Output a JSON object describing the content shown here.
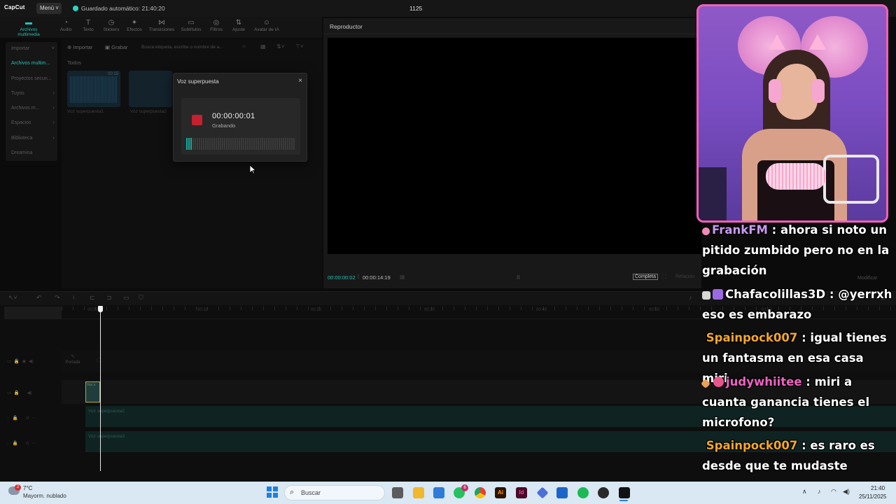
{
  "app": {
    "logo": "CapCut",
    "menu_label": "Menú",
    "autosave": "Guardado automático: 21:40:20",
    "project_title": "1125"
  },
  "tool_tabs": [
    {
      "label": "Archivos multimedia",
      "icon": "media-icon"
    },
    {
      "label": "Audio",
      "icon": "audio-icon"
    },
    {
      "label": "Texto",
      "icon": "text-icon"
    },
    {
      "label": "Stickers",
      "icon": "sticker-icon"
    },
    {
      "label": "Efectos",
      "icon": "effects-icon"
    },
    {
      "label": "Transiciones",
      "icon": "transitions-icon"
    },
    {
      "label": "Subtítulos",
      "icon": "subtitles-icon"
    },
    {
      "label": "Filtros",
      "icon": "filters-icon"
    },
    {
      "label": "Ajuste",
      "icon": "adjust-icon"
    },
    {
      "label": "Avatar de IA",
      "icon": "avatar-icon"
    }
  ],
  "left_nav": [
    {
      "label": "Importar",
      "chevron": "˅"
    },
    {
      "label": "Archivos multim..."
    },
    {
      "label": "Proyectos secun..."
    },
    {
      "label": "Tuyos",
      "chevron": "›"
    },
    {
      "label": "Archivos m...",
      "chevron": "›"
    },
    {
      "label": "Espacios",
      "chevron": "›"
    },
    {
      "label": "Biblioteca",
      "chevron": "›"
    },
    {
      "label": "Dreamina"
    }
  ],
  "media": {
    "import_label": "Importar",
    "record_label": "Grabar",
    "search_placeholder": "Busca etiqueta, escribe o nombre de a...",
    "all_label": "Todos",
    "items": [
      {
        "name": "Voz superpuesta1",
        "duration": "00:15"
      },
      {
        "name": "Voz superpuesta2",
        "duration": ""
      }
    ]
  },
  "record_dialog": {
    "title": "Voz superpuesta",
    "close": "×",
    "time": "00:00:00:01",
    "status": "Grabando",
    "level": 0.05
  },
  "player": {
    "title": "Reproductor",
    "current_time": "00:00:00:02",
    "total_time": "00:00:14:19",
    "pause": "II",
    "full_label": "Completa",
    "ratio_label": "Relación",
    "modify_label": "Modificar"
  },
  "timeline": {
    "ruler_labels": [
      "00:00",
      "00:10",
      "00:20",
      "00:30",
      "00:40",
      "00:50",
      "01:00"
    ],
    "cover_label": "Portada",
    "clip_label": "Voz s",
    "audio_tracks": [
      "Voz superpuesta2",
      "Voz superpuesta3"
    ]
  },
  "chat": [
    {
      "user": "FrankFM",
      "user_color": "#c99af2",
      "badges": [
        "#f08bb8"
      ],
      "text": " : ahora si noto un pitido zumbido pero no en la grabación"
    },
    {
      "user": "Chafacolillas3D",
      "user_color": "#ffffff",
      "badges": [
        "#d7d7d7",
        "#9b6ae0"
      ],
      "text": " : @yerrxh eso es embarazo"
    },
    {
      "user": "Spainpock007",
      "user_color": "#f2a72a",
      "badges": [],
      "text": " : igual tienes un fantasma en esa casa miri"
    },
    {
      "user": "judywhiitee",
      "user_color": "#ef62c2",
      "badges": [
        "#e8a25a",
        "#e8558a"
      ],
      "text": " : miri a cuanta ganancia tienes el microfono?"
    },
    {
      "user": "Spainpock007",
      "user_color": "#f2a72a",
      "badges": [],
      "text": " : es raro es desde que te mudaste"
    }
  ],
  "taskbar": {
    "temperature": "7°C",
    "weather": "Mayorm. nublado",
    "weather_badge": "2",
    "search_placeholder": "Buscar",
    "whatsapp_badge": "6",
    "clock_time": "21:40",
    "clock_date": "25/11/2025",
    "apps": [
      {
        "name": "file-explorer-icon",
        "color": "#5c5c5c"
      },
      {
        "name": "folder-icon",
        "color": "#f1b72d"
      },
      {
        "name": "store-icon",
        "color": "#2f7bd8"
      },
      {
        "name": "whatsapp-icon",
        "color": "#25c15f"
      },
      {
        "name": "chrome-icon",
        "color": "#e34133"
      },
      {
        "name": "illustrator-icon",
        "color": "#2b1300"
      },
      {
        "name": "indesign-icon",
        "color": "#4b0a2a"
      },
      {
        "name": "app-diamond-icon",
        "color": "#4d6fd8"
      },
      {
        "name": "app-mod-icon",
        "color": "#1d64c8"
      },
      {
        "name": "spotify-icon",
        "color": "#1db954"
      },
      {
        "name": "obs-icon",
        "color": "#2a2a2a"
      },
      {
        "name": "capcut-icon",
        "color": "#111111"
      }
    ]
  }
}
